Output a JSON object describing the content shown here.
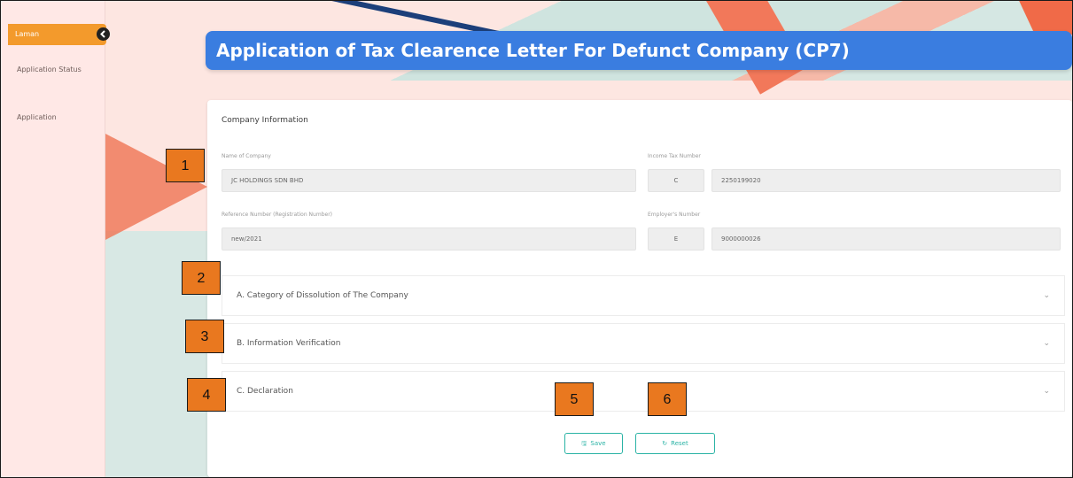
{
  "sidebar": {
    "menu_label": "Laman",
    "collapse_icon": "chevron-left-icon",
    "items": [
      {
        "label": "Application Status"
      },
      {
        "label": "Application"
      }
    ]
  },
  "header": {
    "title": "Application of Tax Clearence Letter For Defunct Company (CP7)"
  },
  "company_info": {
    "section_title": "Company Information",
    "name_label": "Name of Company",
    "name_value": "JC HOLDINGS SDN BHD",
    "tax_label": "Income Tax Number",
    "tax_prefix": "C",
    "tax_value": "2250199020",
    "ref_label": "Reference Number (Registration Number)",
    "ref_value": "new/2021",
    "emp_label": "Employer's Number",
    "emp_prefix": "E",
    "emp_value": "9000000026"
  },
  "sections": [
    {
      "label": "A. Category of Dissolution of The Company",
      "icon": "chevron-down-icon"
    },
    {
      "label": "B. Information Verification",
      "icon": "chevron-down-icon"
    },
    {
      "label": "C. Declaration",
      "icon": "chevron-down-icon"
    }
  ],
  "buttons": {
    "save_label": "Save",
    "save_icon": "save-icon",
    "reset_label": "Reset",
    "reset_icon": "reset-icon"
  },
  "callouts": [
    "1",
    "2",
    "3",
    "4",
    "5",
    "6"
  ]
}
